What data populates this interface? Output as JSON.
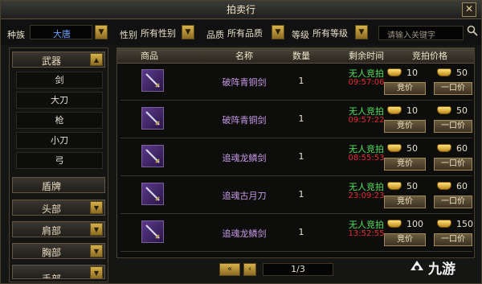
{
  "window": {
    "title": "拍卖行",
    "close_symbol": "✕"
  },
  "filters": {
    "race_label": "种族",
    "race_value": "大唐",
    "gender_label": "性别",
    "gender_value": "所有性别",
    "quality_label": "品质",
    "quality_value": "所有品质",
    "level_label": "等级",
    "level_value": "所有等级",
    "search_placeholder": "请输入关键字"
  },
  "categories": {
    "weapon": "武器",
    "weapon_subs": [
      "剑",
      "大刀",
      "枪",
      "小刀",
      "弓"
    ],
    "shield": "盾牌",
    "head": "头部",
    "shoulder": "肩部",
    "chest": "胸部",
    "more": "手部"
  },
  "table": {
    "headers": [
      "商品",
      "名称",
      "数量",
      "剩余时间",
      "竞拍价格"
    ],
    "bid_label": "竞价",
    "buyout_label": "一口价",
    "rows": [
      {
        "name": "破阵青铜剑",
        "qty": "1",
        "status": "无人竞拍",
        "time": "09:57:06",
        "bid": "10",
        "buyout": "50"
      },
      {
        "name": "破阵青铜剑",
        "qty": "1",
        "status": "无人竞拍",
        "time": "09:57:22",
        "bid": "10",
        "buyout": "50"
      },
      {
        "name": "追魂龙鳞剑",
        "qty": "1",
        "status": "无人竞拍",
        "time": "08:55:53",
        "bid": "50",
        "buyout": "60"
      },
      {
        "name": "追魂古月刀",
        "qty": "1",
        "status": "无人竞拍",
        "time": "23:09:23",
        "bid": "50",
        "buyout": "60"
      },
      {
        "name": "追魂龙鳞剑",
        "qty": "1",
        "status": "无人竞拍",
        "time": "13:52:55",
        "bid": "100",
        "buyout": "150"
      }
    ]
  },
  "pager": {
    "first": "«",
    "prev": "‹",
    "page": "1/3"
  },
  "logo_text": "九游",
  "colors": {
    "item_name": "#c89ae8",
    "status_green": "#53e05a",
    "timer_red": "#e03030",
    "gold": "#d8b24a"
  }
}
